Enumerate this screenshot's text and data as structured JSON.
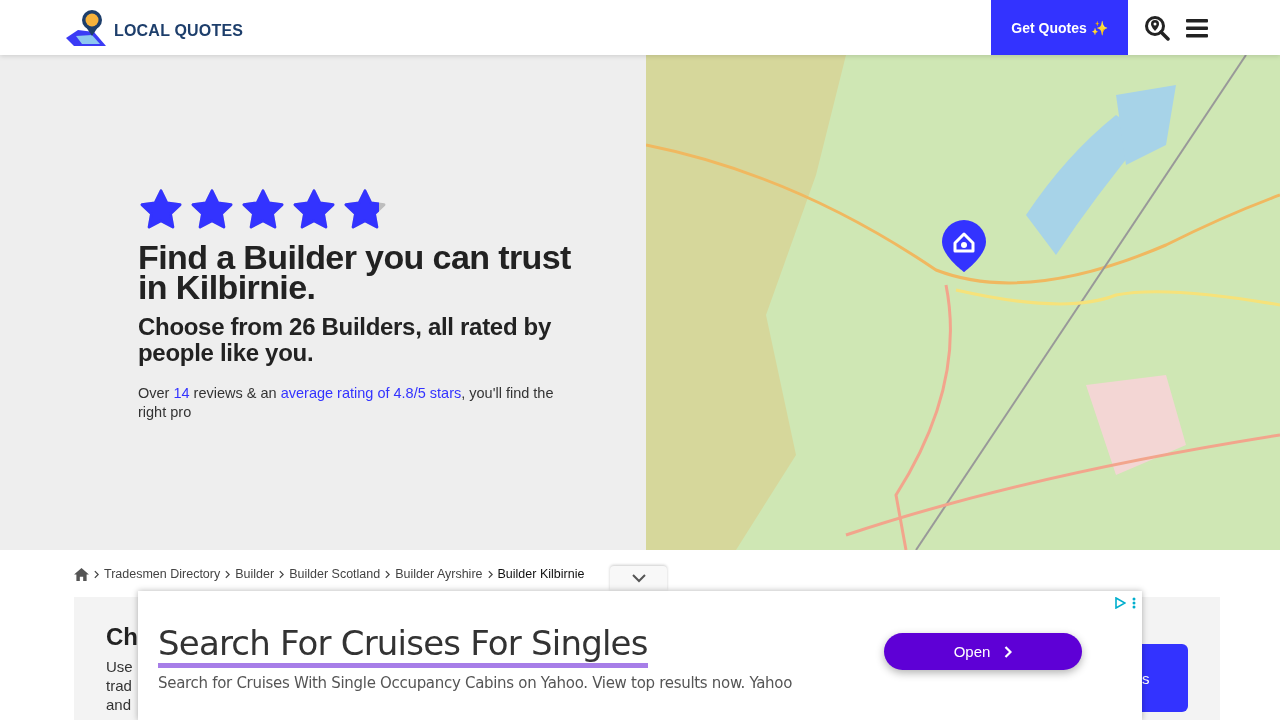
{
  "header": {
    "logo_text": "LOCAL QUOTES",
    "cta": "Get Quotes ✨"
  },
  "hero": {
    "stars": 4.8,
    "title": "Find a Builder you can trust in Kilbirnie.",
    "subtitle": "Choose from **26 Builders**, all rated by people like you.",
    "intro_parts": [
      {
        "text": "Over ",
        "link": false
      },
      {
        "text": "14",
        "link": true
      },
      {
        "text": " reviews & an ",
        "link": false
      },
      {
        "text": "average rating of 4.8/5 stars",
        "link": true
      },
      {
        "text": ", you'll find the right pro",
        "link": false
      }
    ]
  },
  "breadcrumb": [
    {
      "label": "Tradesmen Directory",
      "current": false
    },
    {
      "label": "Builder",
      "current": false
    },
    {
      "label": "Builder Scotland",
      "current": false
    },
    {
      "label": "Builder Ayrshire",
      "current": false
    },
    {
      "label": "Builder Kilbirnie",
      "current": true
    }
  ],
  "section": {
    "heading": "Ch",
    "lines": [
      "Use",
      "trad",
      "and"
    ],
    "button": "s"
  },
  "ad": {
    "headline": "Search For Cruises For Singles",
    "description": "Search for Cruises With Single Occupancy Cabins on Yahoo. View top results now. Yahoo",
    "button": "Open"
  }
}
